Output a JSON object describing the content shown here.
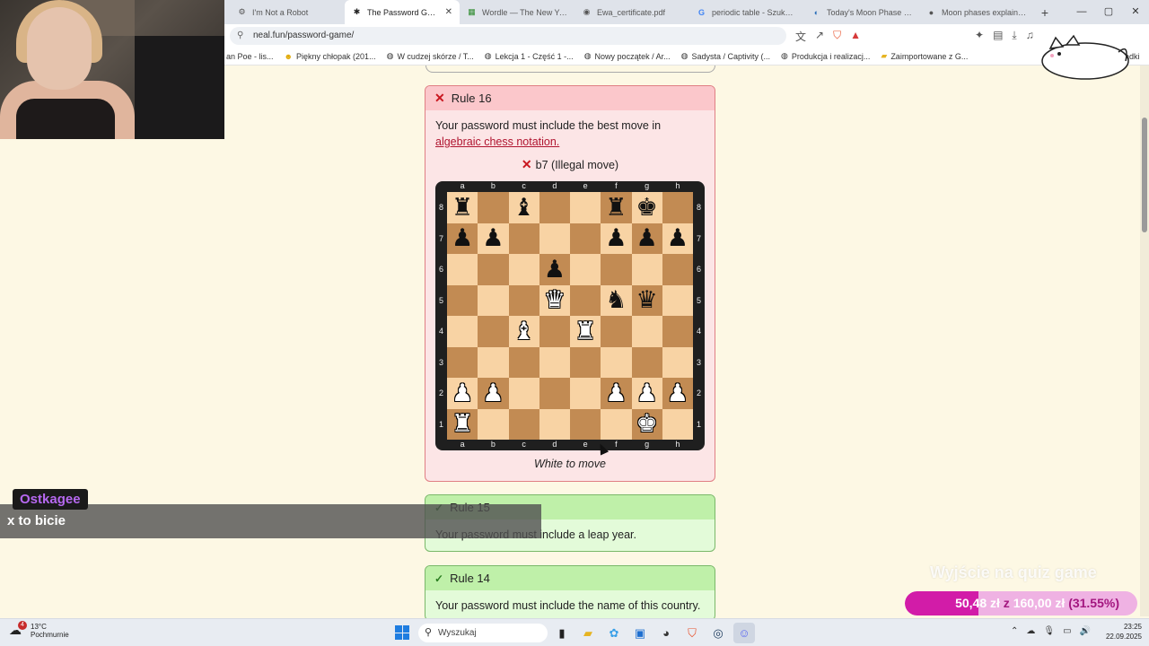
{
  "tabs": [
    {
      "icon": "robot-icon",
      "glyph": "⚙",
      "label": "I'm Not a Robot",
      "active": false
    },
    {
      "icon": "asterisk-icon",
      "glyph": "✱",
      "label": "The Password Game",
      "active": true,
      "close": "✕"
    },
    {
      "icon": "grid-icon",
      "glyph": "▦",
      "label": "Wordle — The New York T",
      "active": false
    },
    {
      "icon": "pdf-icon",
      "glyph": "◉",
      "label": "Ewa_certificate.pdf",
      "active": false
    },
    {
      "icon": "google-icon",
      "glyph": "G",
      "label": "periodic table - Szukaj w G",
      "active": false
    },
    {
      "icon": "moon-icon",
      "glyph": "◐",
      "label": "Today's Moon Phase | Curr",
      "active": false
    },
    {
      "icon": "moon-phases-icon",
      "glyph": "●",
      "label": "Moon phases explained in",
      "active": false
    }
  ],
  "new_tab": "+",
  "window_controls": {
    "minimize": "—",
    "maximize": "▢",
    "close": "✕"
  },
  "address": {
    "url": "neal.fun/password-game/"
  },
  "bookmarks": [
    {
      "label": "an Poe - lis..."
    },
    {
      "label": "Piękny chłopak (201..."
    },
    {
      "label": "W cudzej skórze / T..."
    },
    {
      "label": "Lekcja 1 - Część 1 -..."
    },
    {
      "label": "Nowy początek / Ar..."
    },
    {
      "label": "Sadysta / Captivity (..."
    },
    {
      "label": "Produkcja i realizacj..."
    },
    {
      "label": "Zaimportowane z G..."
    },
    {
      "label": "ładki"
    }
  ],
  "rule16": {
    "title": "Rule 16",
    "desc_prefix": "Your password must include the best move in ",
    "link": "algebraic chess notation.",
    "attempt": "b7 (Illegal move)",
    "to_move": "White to move"
  },
  "board": {
    "files": [
      "a",
      "b",
      "c",
      "d",
      "e",
      "f",
      "g",
      "h"
    ],
    "ranks": [
      "8",
      "7",
      "6",
      "5",
      "4",
      "3",
      "2",
      "1"
    ],
    "rows": [
      [
        "br",
        "",
        "bb",
        "",
        "",
        "br",
        "bk",
        ""
      ],
      [
        "bp",
        "bp",
        "",
        "",
        "",
        "bp",
        "bp",
        "bp"
      ],
      [
        "",
        "",
        "",
        "bp",
        "",
        "",
        "",
        ""
      ],
      [
        "",
        "",
        "",
        "wq",
        "",
        "bn",
        "bq",
        ""
      ],
      [
        "",
        "",
        "wb",
        "",
        "wr",
        "",
        "",
        ""
      ],
      [
        "",
        "",
        "",
        "",
        "",
        "",
        "",
        ""
      ],
      [
        "wp",
        "wp",
        "",
        "",
        "",
        "wp",
        "wp",
        "wp"
      ],
      [
        "wr",
        "",
        "",
        "",
        "",
        "",
        "wk",
        ""
      ]
    ]
  },
  "rule15": {
    "title": "Rule 15",
    "desc": "Your password must include a leap year."
  },
  "rule14": {
    "title": "Rule 14",
    "desc": "Your password must include the name of this country."
  },
  "chat": {
    "username": "Ostkagee",
    "message": "x to bicie"
  },
  "donation": {
    "caption": "Wyjście na quiz game",
    "current": "50,48 zł",
    "sep": "z",
    "target": "160,00 zł",
    "percent_text": "(31.55%)",
    "progress": 0.3155
  },
  "taskbar": {
    "weather_temp": "13°C",
    "weather_desc": "Pochmurnie",
    "weather_badge": "4",
    "search_placeholder": "Wyszukaj",
    "time": "23:25",
    "date": "22.09.2025"
  }
}
